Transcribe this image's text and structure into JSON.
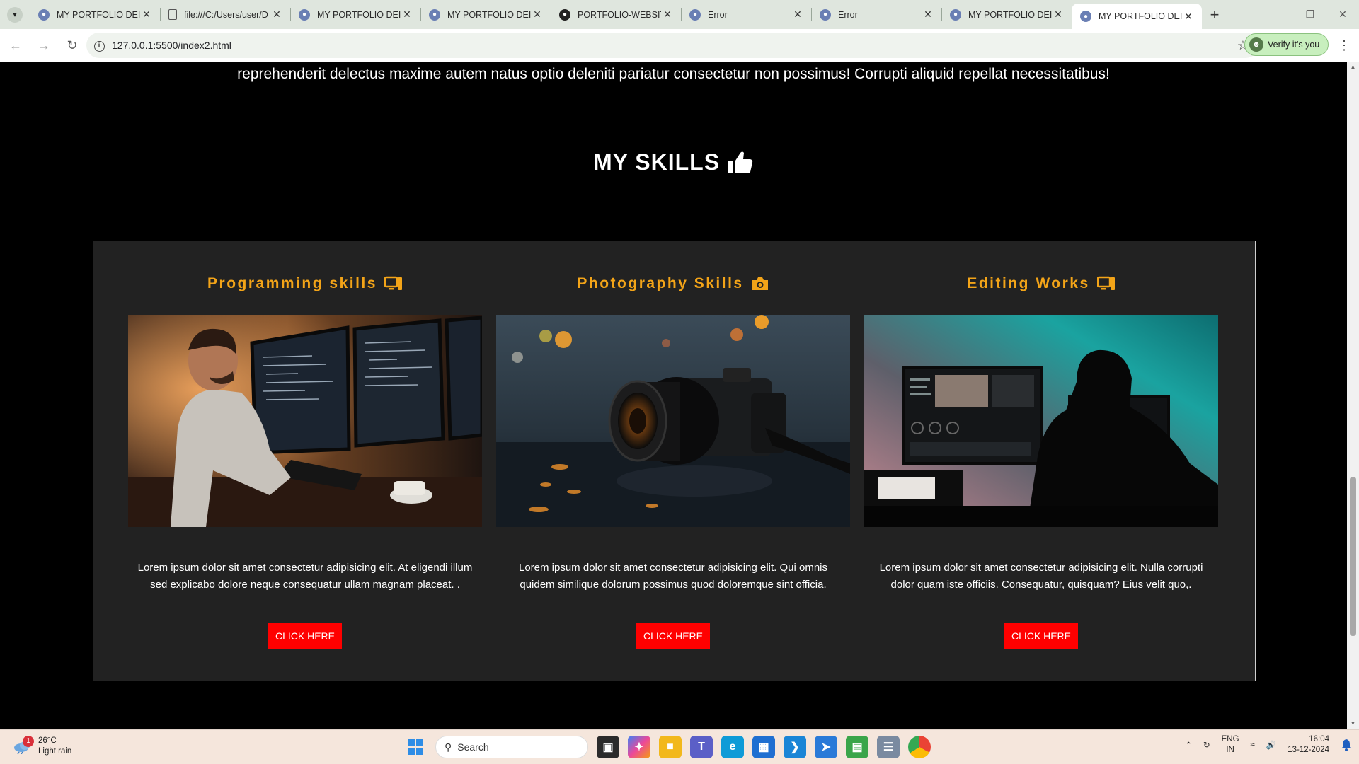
{
  "browser": {
    "tabs": [
      {
        "title": "MY PORTFOLIO DEISGN",
        "icon": "globe-icon",
        "active": false
      },
      {
        "title": "file:///C:/Users/user/D",
        "icon": "file-icon",
        "active": false
      },
      {
        "title": "MY PORTFOLIO DEISGN",
        "icon": "globe-icon",
        "active": false
      },
      {
        "title": "MY PORTFOLIO DEISGN",
        "icon": "globe-icon",
        "active": false
      },
      {
        "title": "PORTFOLIO-WEBSITE",
        "icon": "github-icon",
        "active": false
      },
      {
        "title": "Error",
        "icon": "globe-icon",
        "active": false
      },
      {
        "title": "Error",
        "icon": "globe-icon",
        "active": false
      },
      {
        "title": "MY PORTFOLIO DEISGN",
        "icon": "globe-icon",
        "active": false
      },
      {
        "title": "MY PORTFOLIO DEISGN",
        "icon": "globe-icon",
        "active": true
      }
    ],
    "url": "127.0.0.1:5500/index2.html",
    "verify_label": "Verify it's you"
  },
  "page": {
    "intro_text": "reprehenderit delectus maxime autem natus optio deleniti pariatur consectetur non possimus! Corrupti aliquid repellat necessitatibus!",
    "section_title": "MY SKILLS",
    "cards": [
      {
        "title": "Programming skills",
        "icon": "computer-icon",
        "image": "developer-at-monitors",
        "description": "Lorem ipsum dolor sit amet consectetur adipisicing elit. At eligendi illum sed explicabo dolore neque consequatur ullam magnam placeat. .",
        "button": "CLICK HERE"
      },
      {
        "title": "Photography Skills",
        "icon": "camera-icon",
        "image": "camera-in-rain",
        "description": "Lorem ipsum dolor sit amet consectetur adipisicing elit. Qui omnis quidem similique dolorum possimus quod doloremque sint officia.",
        "button": "CLICK HERE"
      },
      {
        "title": "Editing Works",
        "icon": "computer-icon",
        "image": "video-editor-silhouette",
        "description": "Lorem ipsum dolor sit amet consectetur adipisicing elit. Nulla corrupti dolor quam iste officiis. Consequatur, quisquam? Eius velit quo,.",
        "button": "CLICK HERE"
      }
    ]
  },
  "taskbar": {
    "weather_temp": "26°C",
    "weather_desc": "Light rain",
    "weather_badge": "1",
    "search_placeholder": "Search",
    "lang_top": "ENG",
    "lang_bottom": "IN",
    "time": "16:04",
    "date": "13-12-2024"
  },
  "colors": {
    "accent": "#f3a418",
    "button": "#ff0000",
    "card_bg": "#222222",
    "page_bg": "#000000"
  }
}
